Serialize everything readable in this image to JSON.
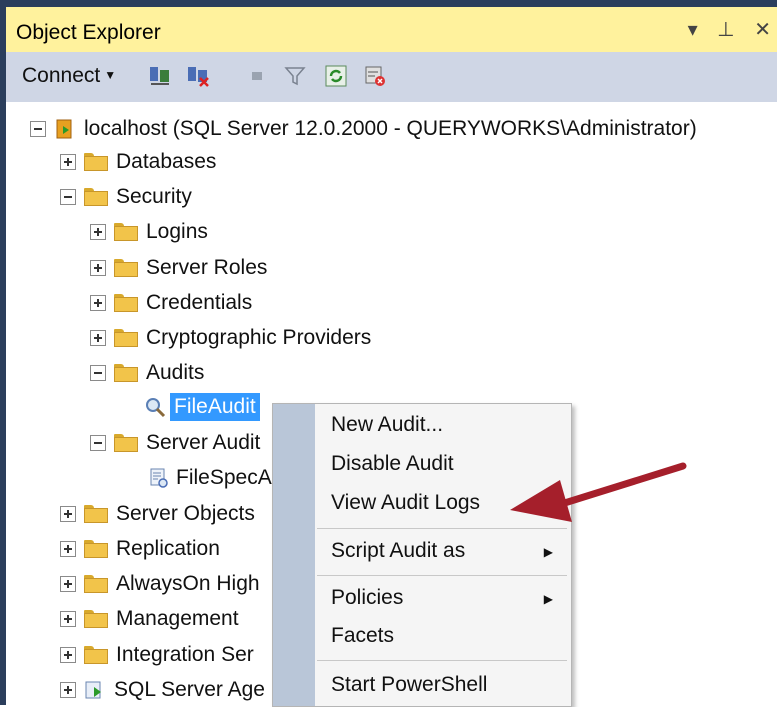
{
  "window": {
    "title": "Object Explorer",
    "controls": [
      "▾",
      "⊥",
      "✕"
    ]
  },
  "toolbar": {
    "connect_label": "Connect",
    "icons": [
      "connect-icon",
      "disconnect-icon",
      "stop-icon",
      "filter-icon",
      "refresh-icon",
      "activity-monitor-icon"
    ]
  },
  "tree": {
    "server": "localhost (SQL Server 12.0.2000 - QUERYWORKS\\Administrator)",
    "databases": "Databases",
    "security": "Security",
    "logins": "Logins",
    "server_roles": "Server Roles",
    "credentials": "Credentials",
    "crypto": "Cryptographic Providers",
    "audits": "Audits",
    "file_audit": "FileAudit",
    "server_audit_spec": "Server Audit",
    "file_spec": "FileSpecA",
    "server_objects": "Server Objects",
    "replication": "Replication",
    "alwayson": "AlwaysOn High",
    "management": "Management",
    "integration": "Integration Ser",
    "agent": "SQL Server Age"
  },
  "context_menu": {
    "new_audit": "New Audit...",
    "disable_audit": "Disable Audit",
    "view_audit_logs": "View Audit Logs",
    "script_audit_as": "Script Audit as",
    "policies": "Policies",
    "facets": "Facets",
    "start_powershell": "Start PowerShell"
  },
  "colors": {
    "titlebar": "#fff29d",
    "toolbar": "#cfd6e5",
    "selection": "#3399ff",
    "menu_gutter": "#b9c6d8",
    "arrow": "#a51f2b"
  }
}
